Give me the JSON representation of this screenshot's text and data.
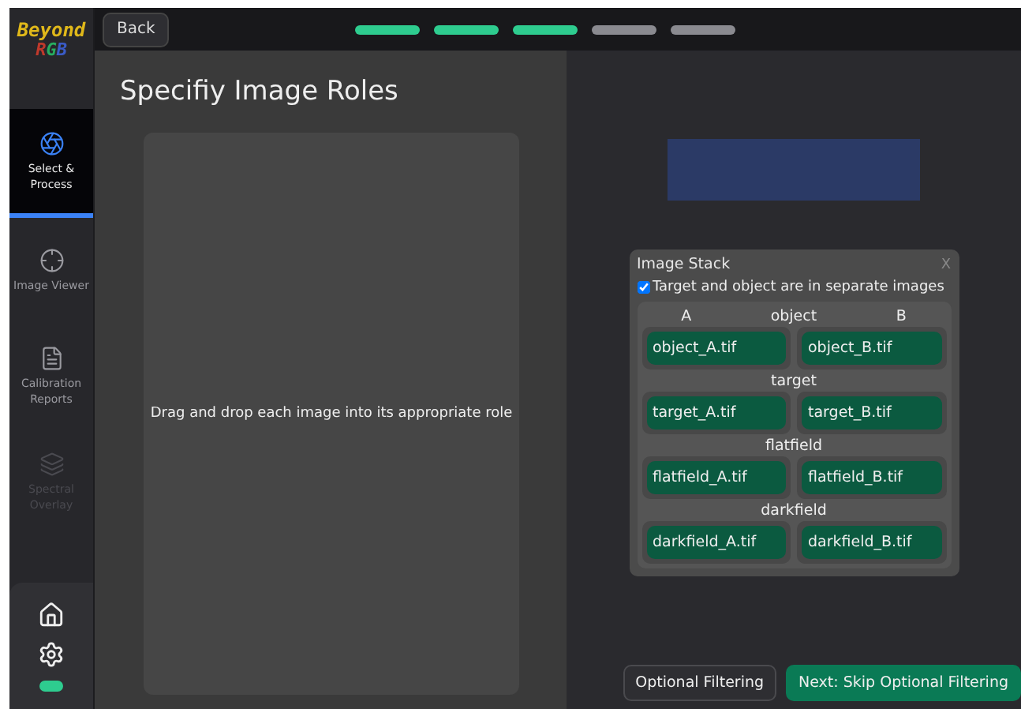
{
  "logo": {
    "line1": "Beyond",
    "line2": [
      {
        "text": "R",
        "color": "#c0392b"
      },
      {
        "text": "G",
        "color": "#27ae60"
      },
      {
        "text": "B",
        "color": "#3a5bc7"
      }
    ]
  },
  "back_button": "Back",
  "progress_steps": [
    {
      "done": true
    },
    {
      "done": true
    },
    {
      "done": true
    },
    {
      "done": false
    },
    {
      "done": false
    }
  ],
  "sidebar": {
    "items": [
      {
        "kind": "aperture",
        "label": "Select & Process",
        "selected": true,
        "disabled": false
      },
      {
        "kind": "crosshair",
        "label": "Image Viewer",
        "selected": false,
        "disabled": false
      },
      {
        "kind": "document",
        "label": "Calibration Reports",
        "selected": false,
        "disabled": false
      },
      {
        "kind": "layers",
        "label": "Spectral Overlay",
        "selected": false,
        "disabled": true
      }
    ]
  },
  "title": "Specifiy Image Roles",
  "drop_zone": {
    "text": "Drag and drop each image into its appropriate role"
  },
  "image_stack": {
    "title": "Image Stack",
    "close": "X",
    "separate_checkbox": {
      "label": "Target and object are in separate images",
      "checked": true
    },
    "column_labels": [
      "A",
      "B"
    ],
    "roles": [
      {
        "name": "object",
        "files": [
          "object_A.tif",
          "object_B.tif"
        ]
      },
      {
        "name": "target",
        "files": [
          "target_A.tif",
          "target_B.tif"
        ]
      },
      {
        "name": "flatfield",
        "files": [
          "flatfield_A.tif",
          "flatfield_B.tif"
        ]
      },
      {
        "name": "darkfield",
        "files": [
          "darkfield_A.tif",
          "darkfield_B.tif"
        ]
      }
    ]
  },
  "buttons": [
    {
      "label": "Optional Filtering",
      "primary": false
    },
    {
      "label": "Next: Skip Optional Filtering",
      "primary": true
    }
  ]
}
